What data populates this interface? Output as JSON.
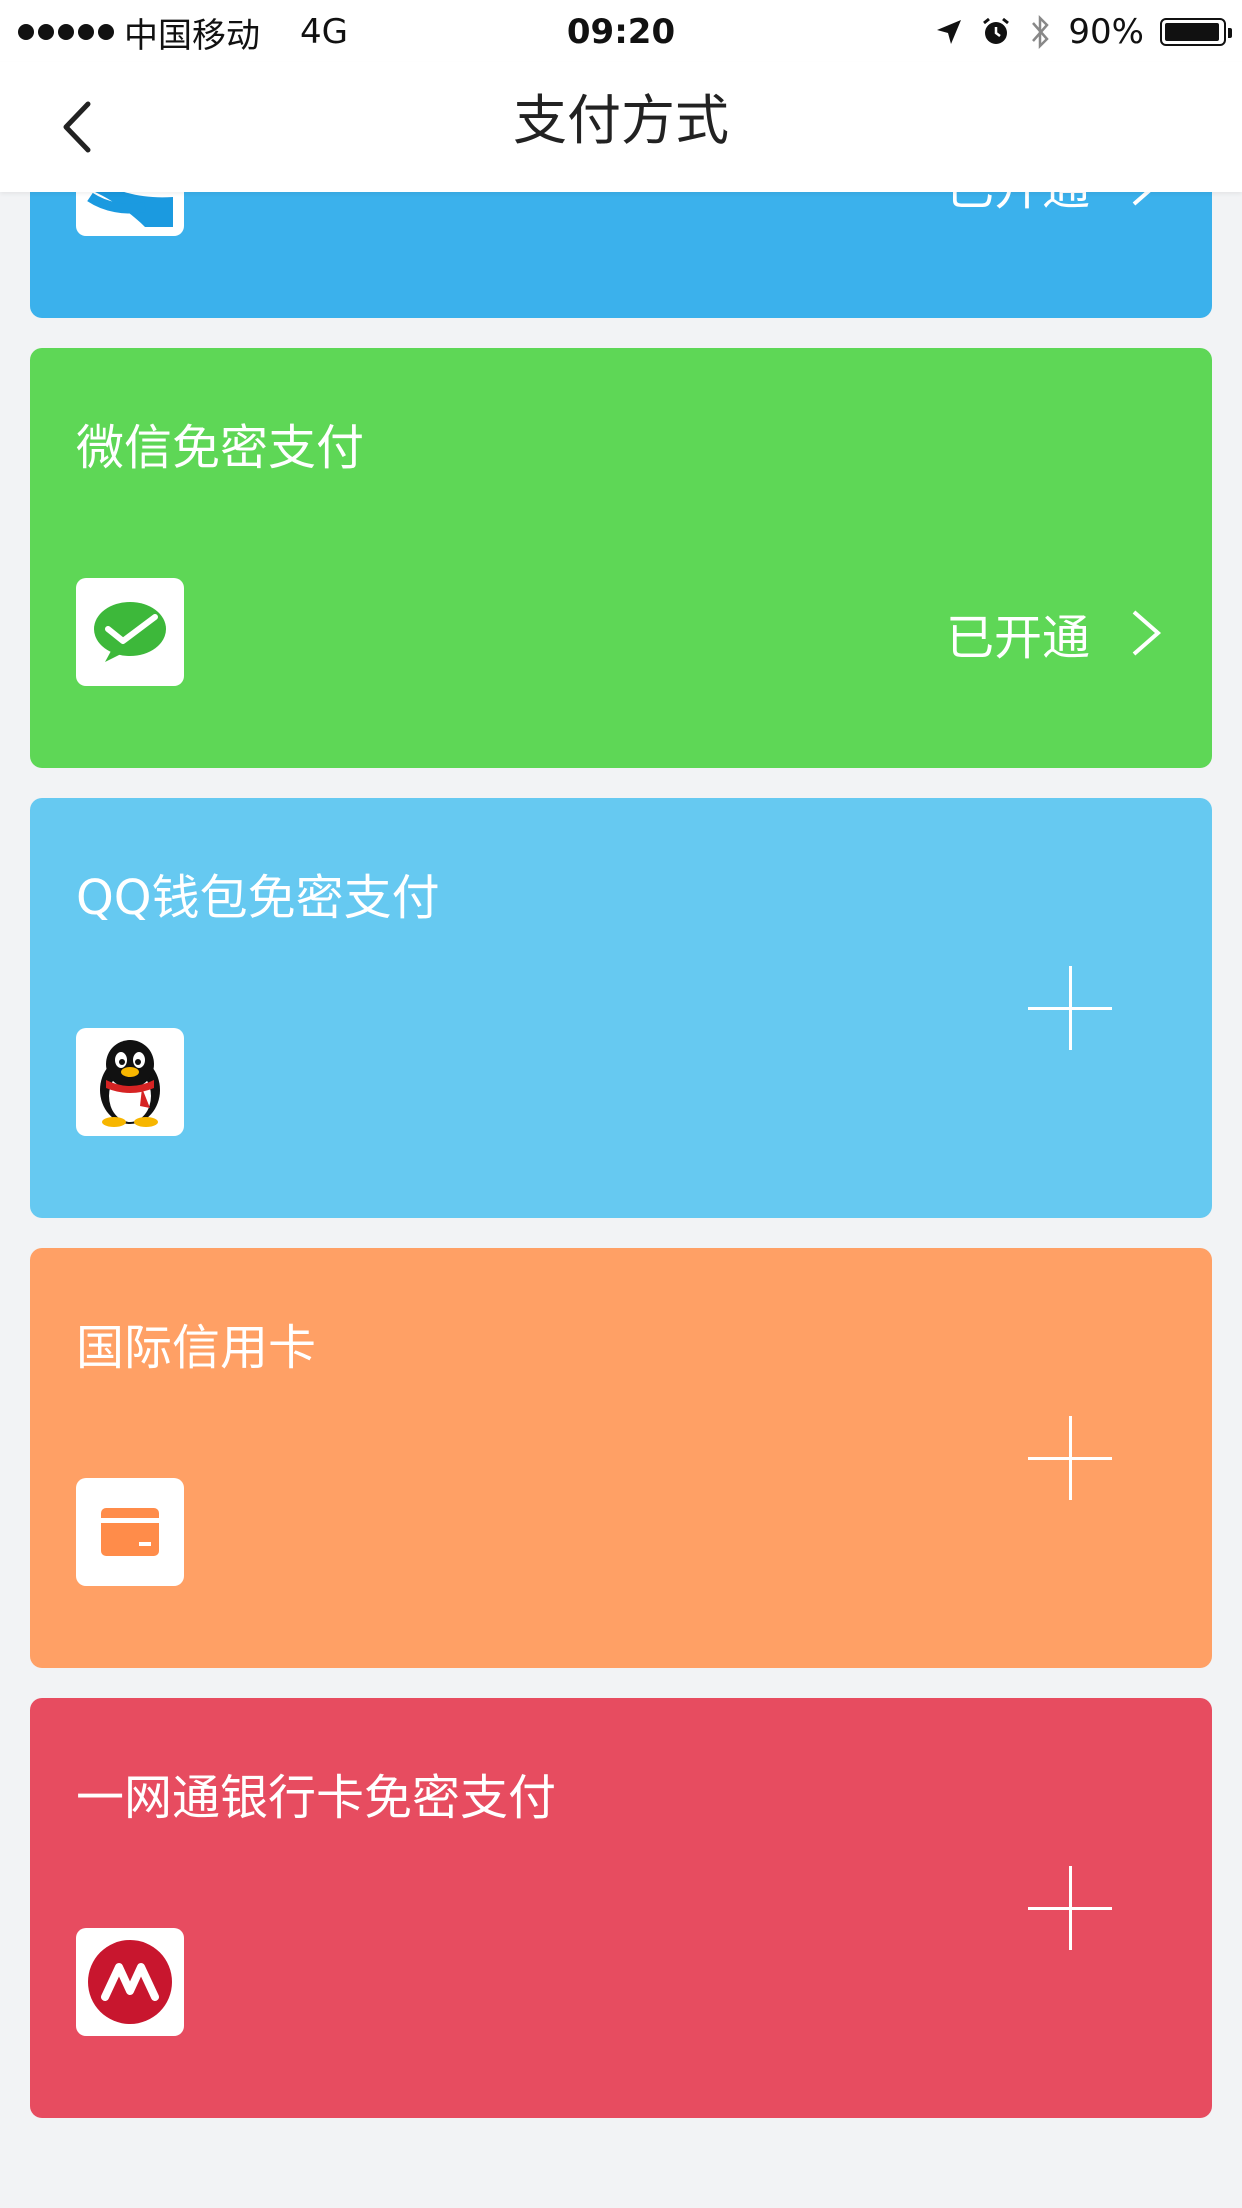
{
  "status_bar": {
    "carrier": "中国移动",
    "network": "4G",
    "time": "09:20",
    "battery": "90%"
  },
  "nav": {
    "title": "支付方式"
  },
  "cards": [
    {
      "title": "",
      "status": "已开通",
      "color": "#3BB1EC"
    },
    {
      "title": "微信免密支付",
      "status": "已开通",
      "color": "#5ED756",
      "icon": "wechat-pay-icon"
    },
    {
      "title": "QQ钱包免密支付",
      "status": "",
      "color": "#66C9F1",
      "icon": "qq-penguin-icon"
    },
    {
      "title": "国际信用卡",
      "status": "",
      "color": "#FFA065",
      "icon": "credit-card-icon"
    },
    {
      "title": "一网通银行卡免密支付",
      "status": "",
      "color": "#E74C60",
      "icon": "cmb-logo-icon"
    }
  ]
}
